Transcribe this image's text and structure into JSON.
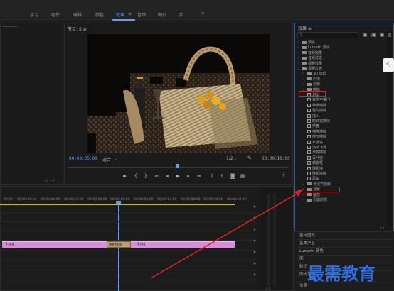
{
  "workspace": {
    "tabs": [
      {
        "label": "学习"
      },
      {
        "label": "组件"
      },
      {
        "label": "编辑"
      },
      {
        "label": "颜色"
      },
      {
        "label": "效果",
        "active": true
      },
      {
        "label": "音频"
      },
      {
        "label": "图形"
      },
      {
        "label": "库"
      }
    ],
    "overflow": "»"
  },
  "program": {
    "title": "节目: S ≡",
    "timecode_left": "00:00:05:00",
    "fit": "适合",
    "fraction": "1/2",
    "timecode_right": "00:00:10:00"
  },
  "timeline": {
    "ruler": [
      "00:00",
      "00:00:01:00",
      "00:00:02:00",
      "00:00:03:00",
      "00:00:04:00",
      "00:00:05:00",
      "00:00:06:00",
      "00:00:07:00",
      "00:00:08:00",
      "00:00:09:00",
      "00:00:10:00"
    ],
    "clips": [
      {
        "label": "1.jpg"
      },
      {
        "label": "随机擦除"
      },
      {
        "label": "2.jpg"
      }
    ]
  },
  "effects": {
    "title": "效果 ≡",
    "search_placeholder": "",
    "items": [
      {
        "label": "预设",
        "kind": "folder",
        "level": 0,
        "twirl": "›"
      },
      {
        "label": "Lumetri 预设",
        "kind": "folder",
        "level": 0,
        "twirl": "›"
      },
      {
        "label": "音频效果",
        "kind": "folder",
        "level": 0,
        "twirl": "›"
      },
      {
        "label": "音频过渡",
        "kind": "folder",
        "level": 0,
        "twirl": "›"
      },
      {
        "label": "视频效果",
        "kind": "folder",
        "level": 0,
        "twirl": "›"
      },
      {
        "label": "视频过渡",
        "kind": "folder",
        "level": 0,
        "twirl": "⌄"
      },
      {
        "label": "3D 运动",
        "kind": "folder",
        "level": 1,
        "twirl": "›"
      },
      {
        "label": "内滑",
        "kind": "folder",
        "level": 1,
        "twirl": "›"
      },
      {
        "label": "划像",
        "kind": "folder",
        "level": 1,
        "twirl": "›"
      },
      {
        "label": "擦除",
        "kind": "folder",
        "level": 1,
        "twirl": "⌄",
        "highlight": true
      },
      {
        "label": "划出",
        "kind": "fx",
        "level": 2
      },
      {
        "label": "双侧平推门",
        "kind": "fx",
        "level": 2
      },
      {
        "label": "带状擦除",
        "kind": "fx",
        "level": 2
      },
      {
        "label": "径向擦除",
        "kind": "fx",
        "level": 2
      },
      {
        "label": "插入",
        "kind": "fx",
        "level": 2
      },
      {
        "label": "时钟式擦除",
        "kind": "fx",
        "level": 2
      },
      {
        "label": "棋盘",
        "kind": "fx",
        "level": 2
      },
      {
        "label": "棋盘擦除",
        "kind": "fx",
        "level": 2
      },
      {
        "label": "楔形擦除",
        "kind": "fx",
        "level": 2
      },
      {
        "label": "水波块",
        "kind": "fx",
        "level": 2
      },
      {
        "label": "油漆飞溅",
        "kind": "fx",
        "level": 2
      },
      {
        "label": "渐变擦除",
        "kind": "fx",
        "level": 2
      },
      {
        "label": "百叶窗",
        "kind": "fx",
        "level": 2
      },
      {
        "label": "螺旋框",
        "kind": "fx",
        "level": 2
      },
      {
        "label": "随机块",
        "kind": "fx",
        "level": 2
      },
      {
        "label": "随机擦除",
        "kind": "fx",
        "level": 2,
        "highlight": true
      },
      {
        "label": "风车",
        "kind": "fx",
        "level": 2
      },
      {
        "label": "沉浸式视频",
        "kind": "folder",
        "level": 1,
        "twirl": "›"
      },
      {
        "label": "溶解",
        "kind": "folder",
        "level": 1,
        "twirl": "›"
      },
      {
        "label": "缩放",
        "kind": "folder",
        "level": 1,
        "twirl": "›"
      },
      {
        "label": "页面剥落",
        "kind": "folder",
        "level": 1,
        "twirl": "›"
      }
    ]
  },
  "side_panels": [
    {
      "label": "基本图形"
    },
    {
      "label": "基本声音"
    },
    {
      "label": "Lumetri 颜色"
    },
    {
      "label": "库"
    },
    {
      "label": "标记"
    },
    {
      "label": "历史记录"
    },
    {
      "label": "信息"
    }
  ],
  "watermark": "最需教育",
  "colors": {
    "accent": "#5aa0ff",
    "clip": "#d68ed8",
    "annotation": "#e02020",
    "watermark": "#2f6fe0"
  }
}
